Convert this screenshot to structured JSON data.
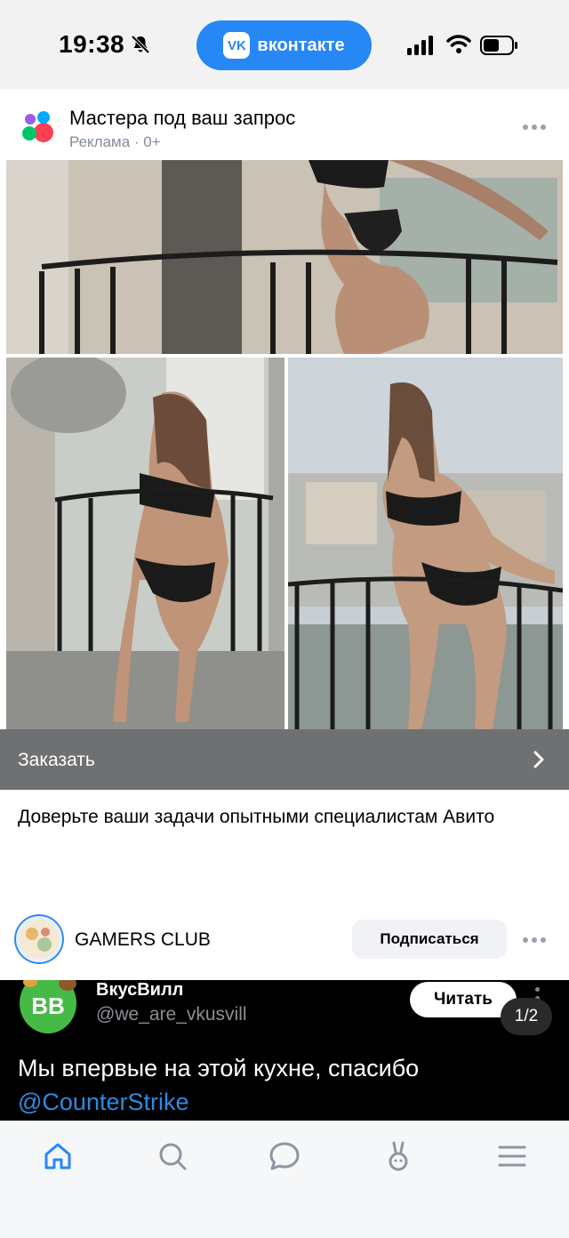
{
  "status_bar": {
    "time": "19:38",
    "app_pill_label": "вконтакте",
    "app_pill_logo": "VK",
    "accent": "#2787f5"
  },
  "ad_post": {
    "title": "Мастера под ваш запрос",
    "meta": "Реклама · 0+",
    "cta_label": "Заказать",
    "description": "Доверьте ваши задачи опытными специалистам Авито",
    "cta_color": "#6e7072"
  },
  "community": {
    "name": "GAMERS CLUB",
    "subscribe_label": "Подписаться"
  },
  "embedded_post": {
    "author_name": "ВкусВилл",
    "author_handle": "@we_are_vkusvill",
    "avatar_text": "ВВ",
    "read_label": "Читать",
    "page_indicator": "1/2",
    "text": "Мы впервые на этой кухне, спасибо",
    "mention": "@CounterStrike"
  },
  "tab_bar": {
    "items": [
      "home-icon",
      "search-icon",
      "messages-icon",
      "clips-icon",
      "menu-icon"
    ],
    "active_color": "#2787f5",
    "inactive_color": "#8c96a3"
  }
}
